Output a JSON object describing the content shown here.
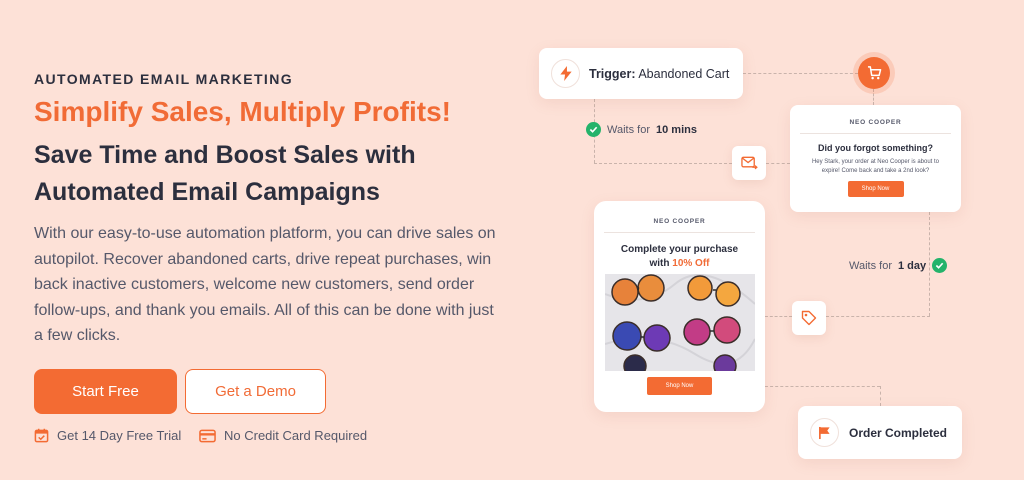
{
  "hero": {
    "eyebrow": "AUTOMATED EMAIL MARKETING",
    "headline": "Simplify Sales, Multiply Profits!",
    "subhead": "Save Time and Boost Sales with Automated Email Campaigns",
    "body": "With our easy-to-use automation platform, you can drive sales on autopilot. Recover abandoned carts, drive repeat purchases, win back inactive customers, welcome new customers, send order follow-ups, and thank you emails. All of this can be done with just a few clicks.",
    "primary_button": "Start Free",
    "secondary_button": "Get a Demo",
    "perks": [
      "Get 14 Day Free Trial",
      "No Credit Card Required"
    ]
  },
  "flow": {
    "trigger_label": "Trigger:",
    "trigger_value": "Abandoned Cart",
    "wait1_prefix": "Waits for",
    "wait1_value": "10 mins",
    "wait2_prefix": "Waits for",
    "wait2_value": "1 day",
    "email1": {
      "brand": "NEO COOPER",
      "title": "Did you forgot something?",
      "body": "Hey Stark, your order at Neo Cooper is about to expire! Come back and take a 2nd look?",
      "button": "Shop Now"
    },
    "email2": {
      "brand": "NEO COOPER",
      "title_prefix": "Complete your purchase with",
      "title_accent": "10% Off",
      "button": "Shop Now"
    },
    "final_step": "Order Completed"
  },
  "colors": {
    "background": "#fde1d7",
    "accent": "#f36b33",
    "text_dark": "#2c2f3e",
    "success": "#24b36b"
  },
  "icons": [
    "lightning-icon",
    "cart-icon",
    "check-icon",
    "email-forward-icon",
    "tag-icon",
    "flag-icon",
    "calendar-check-icon",
    "credit-card-icon"
  ]
}
